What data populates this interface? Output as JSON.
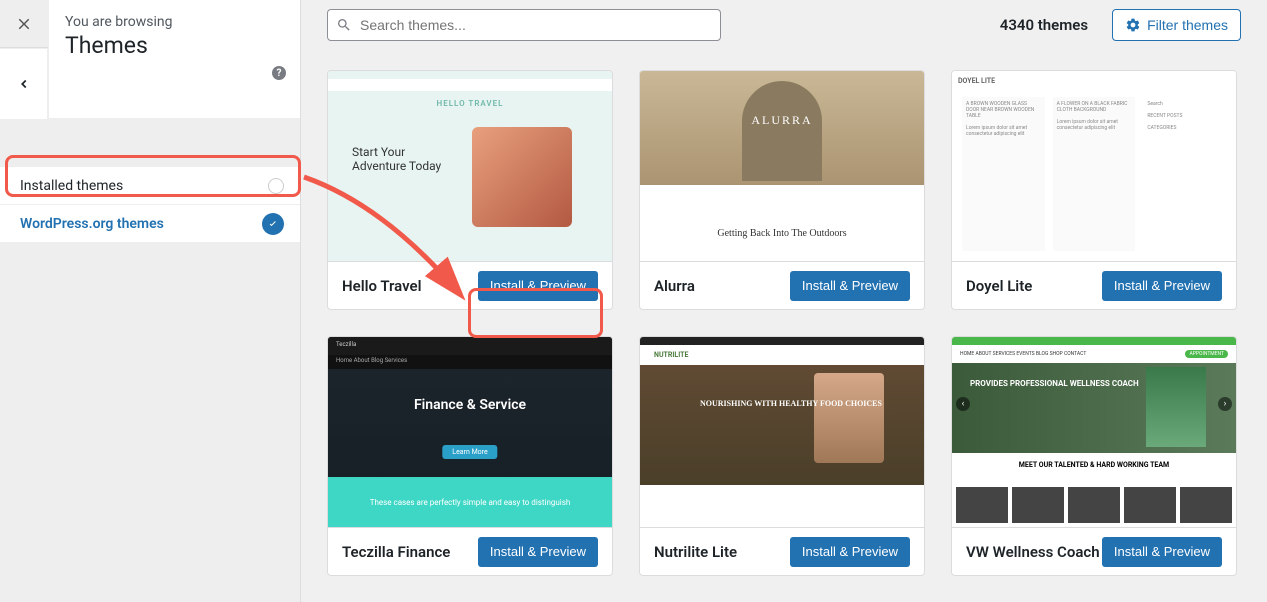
{
  "sidebar": {
    "browsing_label": "You are browsing",
    "title": "Themes",
    "filters": [
      {
        "label": "Installed themes",
        "active": false
      },
      {
        "label": "WordPress.org themes",
        "active": true
      }
    ]
  },
  "search": {
    "placeholder": "Search themes..."
  },
  "header": {
    "count_text": "4340 themes",
    "filter_button": "Filter themes"
  },
  "install_label": "Install & Preview",
  "themes": [
    {
      "name": "Hello Travel"
    },
    {
      "name": "Alurra"
    },
    {
      "name": "Doyel Lite"
    },
    {
      "name": "Teczilla Finance"
    },
    {
      "name": "Nutrilite Lite"
    },
    {
      "name": "VW Wellness Coach"
    }
  ],
  "thumbs": {
    "t1": {
      "logo": "HELLO TRAVEL",
      "headline": "Start Your Adventure Today"
    },
    "t2": {
      "title": "ALURRA",
      "subtitle": "Getting Back Into The Outdoors"
    },
    "t3": {
      "logo": "DOYEL LITE"
    },
    "t4": {
      "brand": "Teczilla",
      "title": "Finance & Service",
      "button": "Learn More",
      "strip": "These cases are perfectly simple and easy to distinguish"
    },
    "t5": {
      "logo": "NUTRILITE",
      "hero": "NOURISHING WITH HEALTHY FOOD CHOICES"
    },
    "t6": {
      "hero": "PROVIDES PROFESSIONAL WELLNESS COACH",
      "band": "MEET OUR TALENTED & HARD WORKING TEAM"
    }
  }
}
